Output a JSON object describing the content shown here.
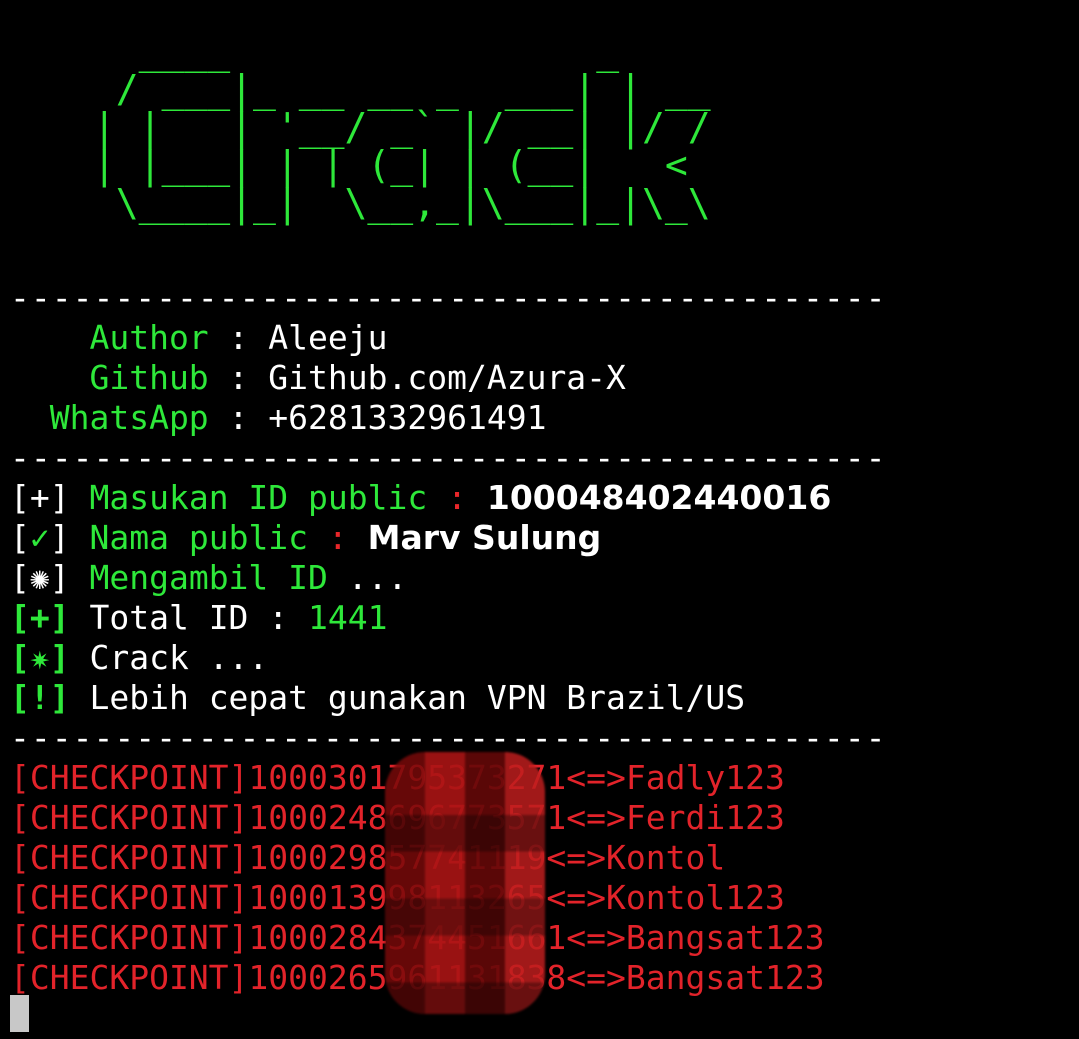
{
  "banner": {
    "ascii": "   ____                _    \n  / ___|_ __ __ _  ___| | __\n | |   | '__/ _` |/ __| |/ /\n | |___| | | (_| | (__|   < \n  \\____|_|  \\__,_|\\___|_|\\_\\"
  },
  "divider": "------------------------------------------",
  "info": {
    "author_label": "    Author",
    "author_sep": " : ",
    "author_value": "Aleeju",
    "github_label": "    Github",
    "github_sep": " : ",
    "github_value": "Github.com/Azura-X",
    "whatsapp_label": "  WhatsApp",
    "whatsapp_sep": " : ",
    "whatsapp_value": "+6281332961491"
  },
  "prompts": {
    "id_prefix": "[+] ",
    "id_label": "Masukan ID public ",
    "id_colon": ": ",
    "id_value": "100048402440016",
    "name_prefix_open": "[",
    "name_prefix_mark": "✓",
    "name_prefix_close": "] ",
    "name_label": "Nama public ",
    "name_colon": ": ",
    "name_value": "Marv Sulung",
    "fetch_prefix": "[✺] ",
    "fetch_label": "Mengambil ID",
    "fetch_dots": " ...",
    "total_prefix": "[+] ",
    "total_label": "Total ID : ",
    "total_value": "1441",
    "crack_prefix": "[✷] ",
    "crack_label": "Crack ...",
    "vpn_prefix": "[!] ",
    "vpn_label": "Lebih cepat gunakan VPN Brazil/US"
  },
  "results": [
    {
      "text": "[CHECKPOINT]1000301795373271<=>Fadly123"
    },
    {
      "text": "[CHECKPOINT]1000248696773571<=>Ferdi123"
    },
    {
      "text": "[CHECKPOINT]100029857741119<=>Kontol"
    },
    {
      "text": "[CHECKPOINT]100013998113265<=>Kontol123"
    },
    {
      "text": "[CHECKPOINT]1000284374451661<=>Bangsat123"
    },
    {
      "text": "[CHECKPOINT]1000265961131838<=>Bangsat123"
    }
  ],
  "colors": {
    "background": "#000000",
    "green": "#2ee83a",
    "red": "#e2232a",
    "text": "#ffffff"
  }
}
